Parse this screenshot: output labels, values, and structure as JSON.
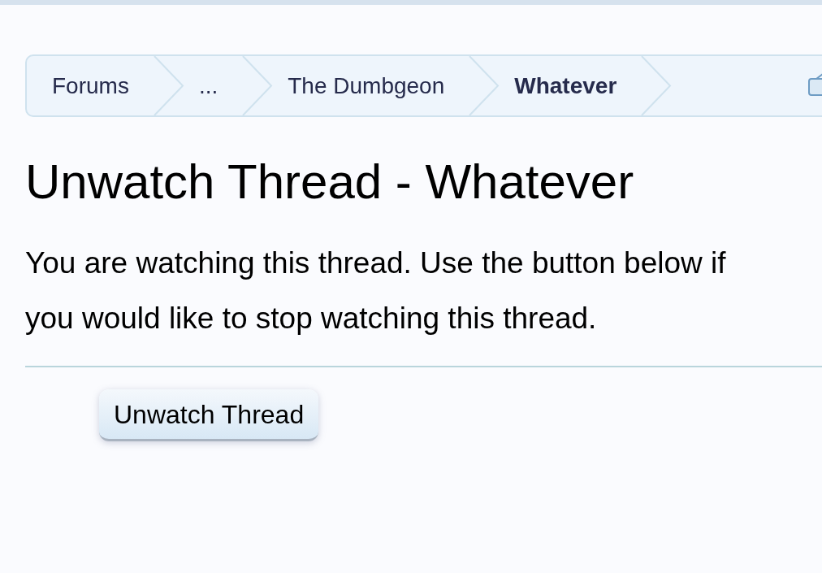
{
  "breadcrumb": [
    {
      "label": "Forums",
      "current": false
    },
    {
      "label": "...",
      "current": false
    },
    {
      "label": "The Dumbgeon",
      "current": false
    },
    {
      "label": "Whatever",
      "current": true
    }
  ],
  "title": "Unwatch Thread - Whatever",
  "message": "You are watching this thread. Use the button below if you would like to stop watching this thread.",
  "button": "Unwatch Thread"
}
